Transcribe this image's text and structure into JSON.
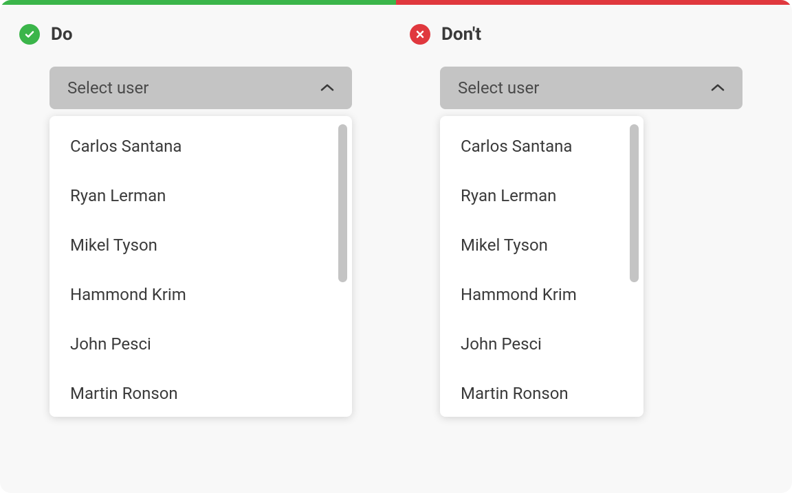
{
  "do": {
    "title": "Do",
    "select_label": "Select user",
    "items": [
      "Carlos Santana",
      "Ryan Lerman",
      "Mikel Tyson",
      "Hammond Krim",
      "John Pesci",
      "Martin Ronson"
    ]
  },
  "dont": {
    "title": "Don't",
    "select_label": "Select user",
    "items": [
      "Carlos Santana",
      "Ryan Lerman",
      "Mikel Tyson",
      "Hammond Krim",
      "John Pesci",
      "Martin Ronson"
    ]
  },
  "colors": {
    "green": "#3BB54A",
    "red": "#E0383E"
  }
}
